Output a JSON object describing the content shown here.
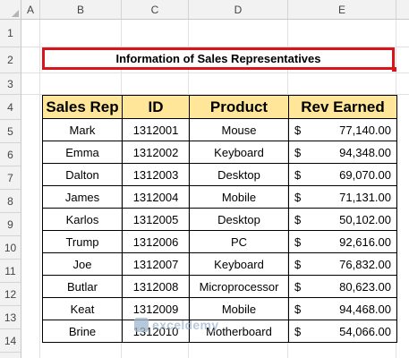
{
  "columns": [
    "A",
    "B",
    "C",
    "D",
    "E"
  ],
  "rows": [
    "1",
    "2",
    "3",
    "4",
    "5",
    "6",
    "7",
    "8",
    "9",
    "10",
    "11",
    "12",
    "13",
    "14"
  ],
  "title": "Information of Sales Representatives",
  "headers": [
    "Sales Rep",
    "ID",
    "Product",
    "Rev Earned"
  ],
  "records": [
    {
      "rep": "Mark",
      "id": "1312001",
      "product": "Mouse",
      "currency": "$",
      "rev": "77,140.00"
    },
    {
      "rep": "Emma",
      "id": "1312002",
      "product": "Keyboard",
      "currency": "$",
      "rev": "94,348.00"
    },
    {
      "rep": "Dalton",
      "id": "1312003",
      "product": "Desktop",
      "currency": "$",
      "rev": "69,070.00"
    },
    {
      "rep": "James",
      "id": "1312004",
      "product": "Mobile",
      "currency": "$",
      "rev": "71,131.00"
    },
    {
      "rep": "Karlos",
      "id": "1312005",
      "product": "Desktop",
      "currency": "$",
      "rev": "50,102.00"
    },
    {
      "rep": "Trump",
      "id": "1312006",
      "product": "PC",
      "currency": "$",
      "rev": "92,616.00"
    },
    {
      "rep": "Joe",
      "id": "1312007",
      "product": "Keyboard",
      "currency": "$",
      "rev": "76,832.00"
    },
    {
      "rep": "Butlar",
      "id": "1312008",
      "product": "Microprocessor",
      "currency": "$",
      "rev": "80,623.00"
    },
    {
      "rep": "Keat",
      "id": "1312009",
      "product": "Mobile",
      "currency": "$",
      "rev": "94,468.00"
    },
    {
      "rep": "Brine",
      "id": "1312010",
      "product": "Motherboard",
      "currency": "$",
      "rev": "54,066.00"
    }
  ],
  "watermark": "exceldemy",
  "colors": {
    "header_fill": "#ffe699",
    "title_border": "#d9151b"
  }
}
